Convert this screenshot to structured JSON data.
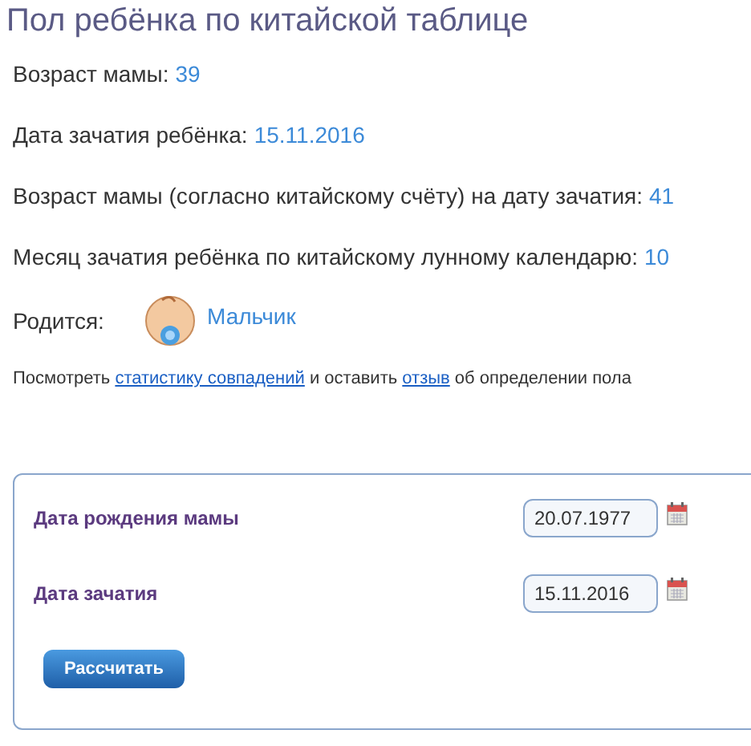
{
  "title": "Пол ребёнка по китайской таблице",
  "results": [
    {
      "label": "Возраст мамы:",
      "value": "39"
    },
    {
      "label": "Дата зачатия ребёнка:",
      "value": "15.11.2016"
    },
    {
      "label": "Возраст мамы (согласно китайскому счёту) на дату зачатия:",
      "value": "41"
    },
    {
      "label": "Месяц зачатия ребёнка по китайскому лунному календарю:",
      "value": "10"
    }
  ],
  "outcome": {
    "label": "Родится:",
    "value": "Мальчик"
  },
  "note": [
    {
      "kind": "text",
      "text": "Посмотреть "
    },
    {
      "kind": "link",
      "text": "статистику совпадений"
    },
    {
      "kind": "text",
      "text": " и оставить "
    },
    {
      "kind": "link",
      "text": "отзыв"
    },
    {
      "kind": "text",
      "text": " об определении пола"
    }
  ],
  "form": {
    "fields": [
      {
        "label": "Дата рождения мамы",
        "value": "20.07.1977"
      },
      {
        "label": "Дата зачатия",
        "value": "15.11.2016"
      }
    ],
    "button": "Рассчитать"
  }
}
